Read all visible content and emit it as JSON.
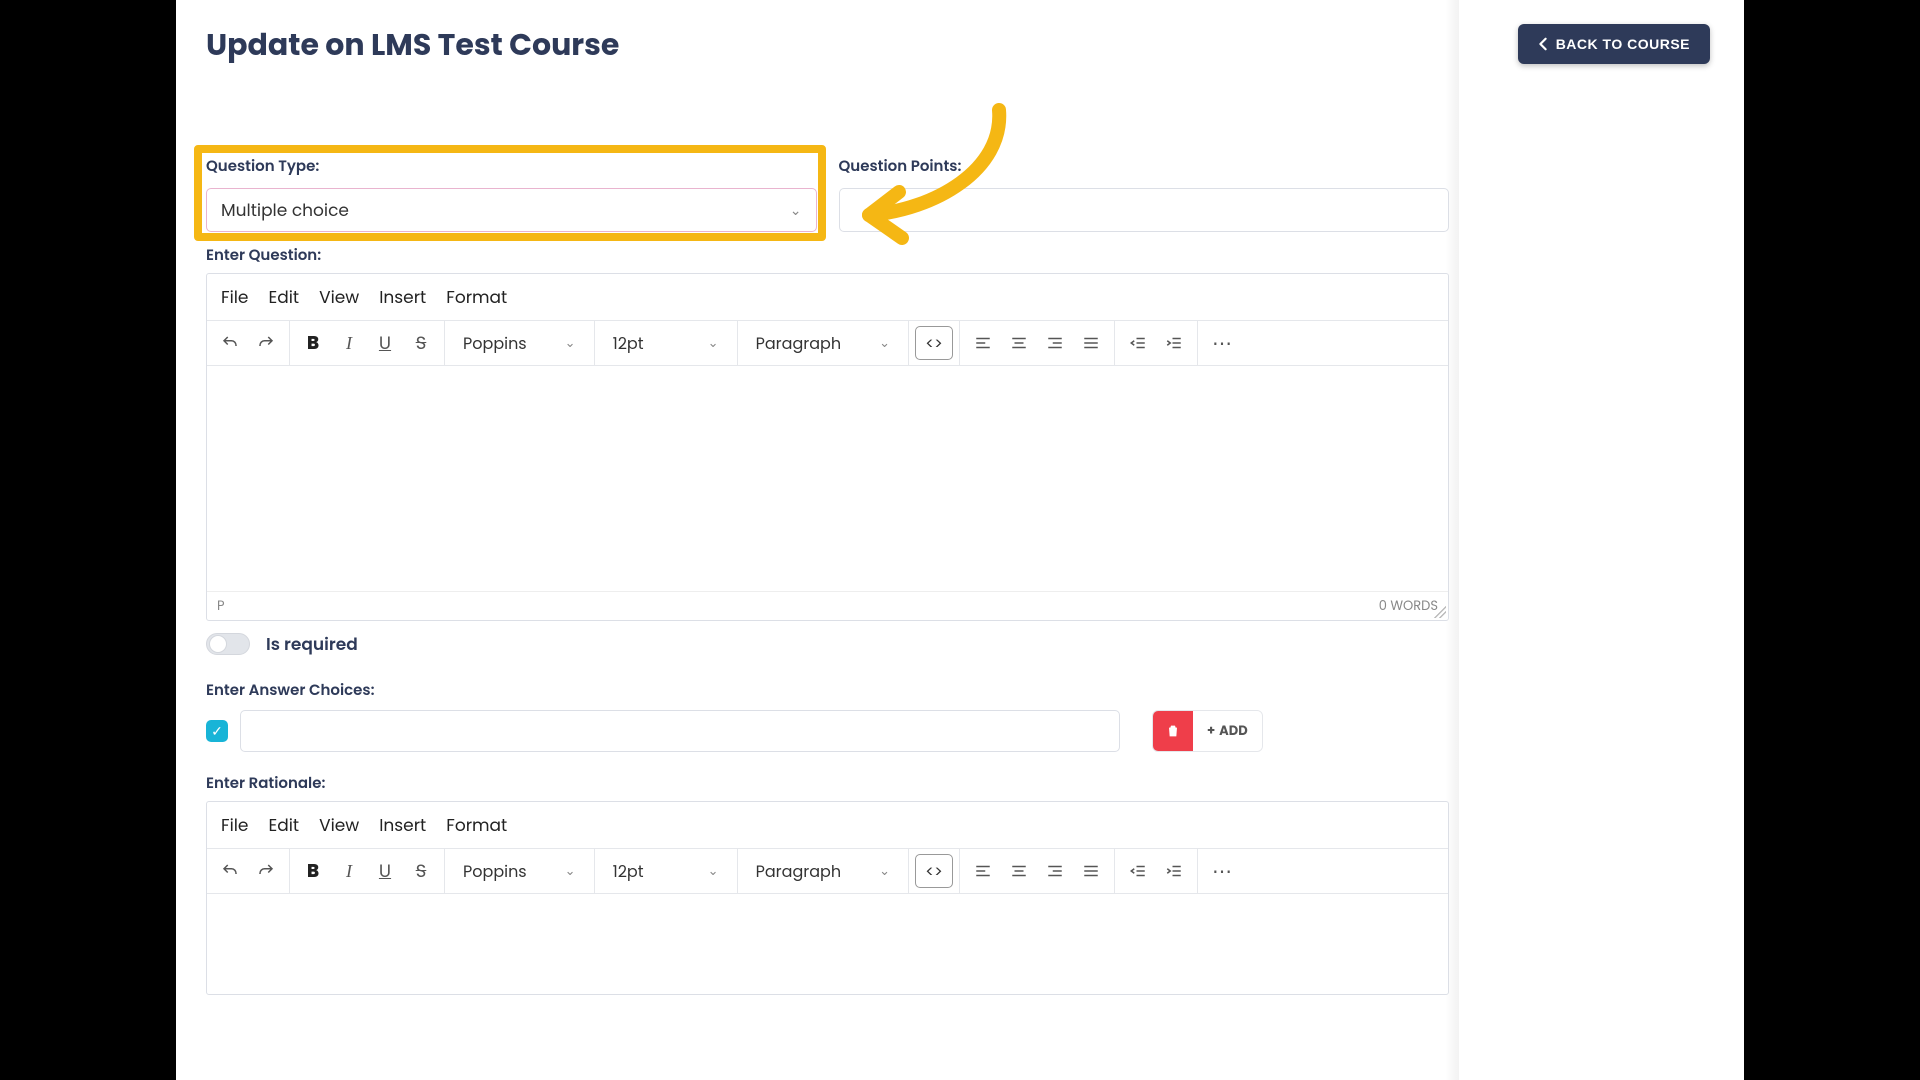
{
  "header": {
    "title": "Update on LMS Test Course",
    "back_label": "BACK TO COURSE"
  },
  "question_type": {
    "label": "Question Type:",
    "value": "Multiple choice"
  },
  "question_points": {
    "label": "Question Points:",
    "value": ""
  },
  "enter_question_label": "Enter Question:",
  "editor": {
    "menus": {
      "file": "File",
      "edit": "Edit",
      "view": "View",
      "insert": "Insert",
      "format": "Format"
    },
    "font": "Poppins",
    "font_size": "12pt",
    "block": "Paragraph",
    "status_path": "P",
    "word_count": "0 WORDS"
  },
  "is_required": {
    "label": "Is required",
    "on": false
  },
  "answer_choices": {
    "label": "Enter Answer Choices:",
    "items": [
      {
        "checked": true,
        "text": ""
      }
    ],
    "add_label": "ADD"
  },
  "rationale": {
    "label": "Enter Rationale:"
  }
}
